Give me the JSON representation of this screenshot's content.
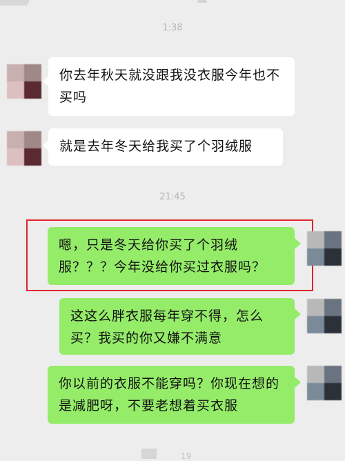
{
  "chat": {
    "timestamps": {
      "first": "1:38",
      "second": "21:45",
      "bottom_partial": "19"
    },
    "messages": [
      {
        "side": "received",
        "text": "你去年秋天就没跟我没衣服今年也不买吗"
      },
      {
        "side": "received",
        "text": "就是去年冬天给我买了个羽绒服"
      },
      {
        "side": "sent",
        "text": "嗯，只是冬天给你买了个羽绒服？？？今年没给你买过衣服吗？",
        "highlighted": true
      },
      {
        "side": "sent",
        "text": "这这么胖衣服每年穿不得，怎么买？我买的你又嫌不满意"
      },
      {
        "side": "sent",
        "text": "你以前的衣服不能穿吗？你现在想的是减肥呀，不要老想着买衣服"
      }
    ]
  },
  "colors": {
    "background": "#ededed",
    "received_bubble": "#ffffff",
    "sent_bubble": "#95ec69",
    "highlight_border": "#e0242b",
    "timestamp_text": "#b5b5b5"
  },
  "avatars": {
    "contact": [
      "#c8b0b0",
      "#a08888",
      "#dcc0c0",
      "#5a2a30"
    ],
    "self": [
      "#b8b8b8",
      "#6a7480",
      "#7a8a98",
      "#2c3038"
    ]
  }
}
